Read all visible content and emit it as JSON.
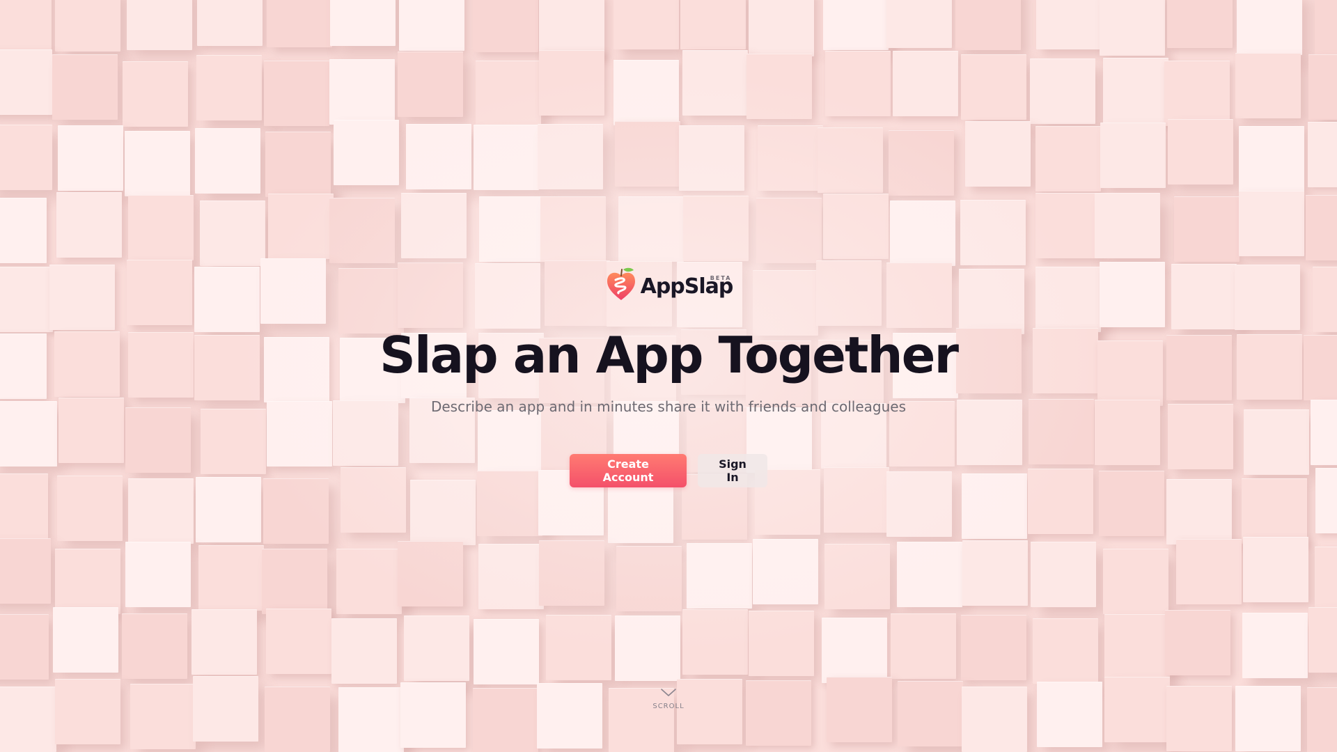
{
  "background": {
    "pattern": "extruded-cube-tiles",
    "colors": [
      "#fbdedb",
      "#fde8e6",
      "#f8d6d3",
      "#fff0ef"
    ]
  },
  "brand": {
    "name": "AppSlap",
    "badge": "BETA",
    "logo_icon": "peach-heart-logo-icon",
    "colors": {
      "logo_top": "#ff8a5c",
      "logo_bottom": "#ee3f66",
      "leaf": "#7cc94d"
    }
  },
  "hero": {
    "title": "Slap an App Together",
    "subtitle": "Describe an app and in minutes share it with friends and colleagues"
  },
  "actions": {
    "create_account_label": "Create Account",
    "sign_in_label": "Sign In",
    "accent": "#f4506a"
  },
  "scroll": {
    "label": "SCROLL",
    "icon": "chevron-down-icon"
  }
}
